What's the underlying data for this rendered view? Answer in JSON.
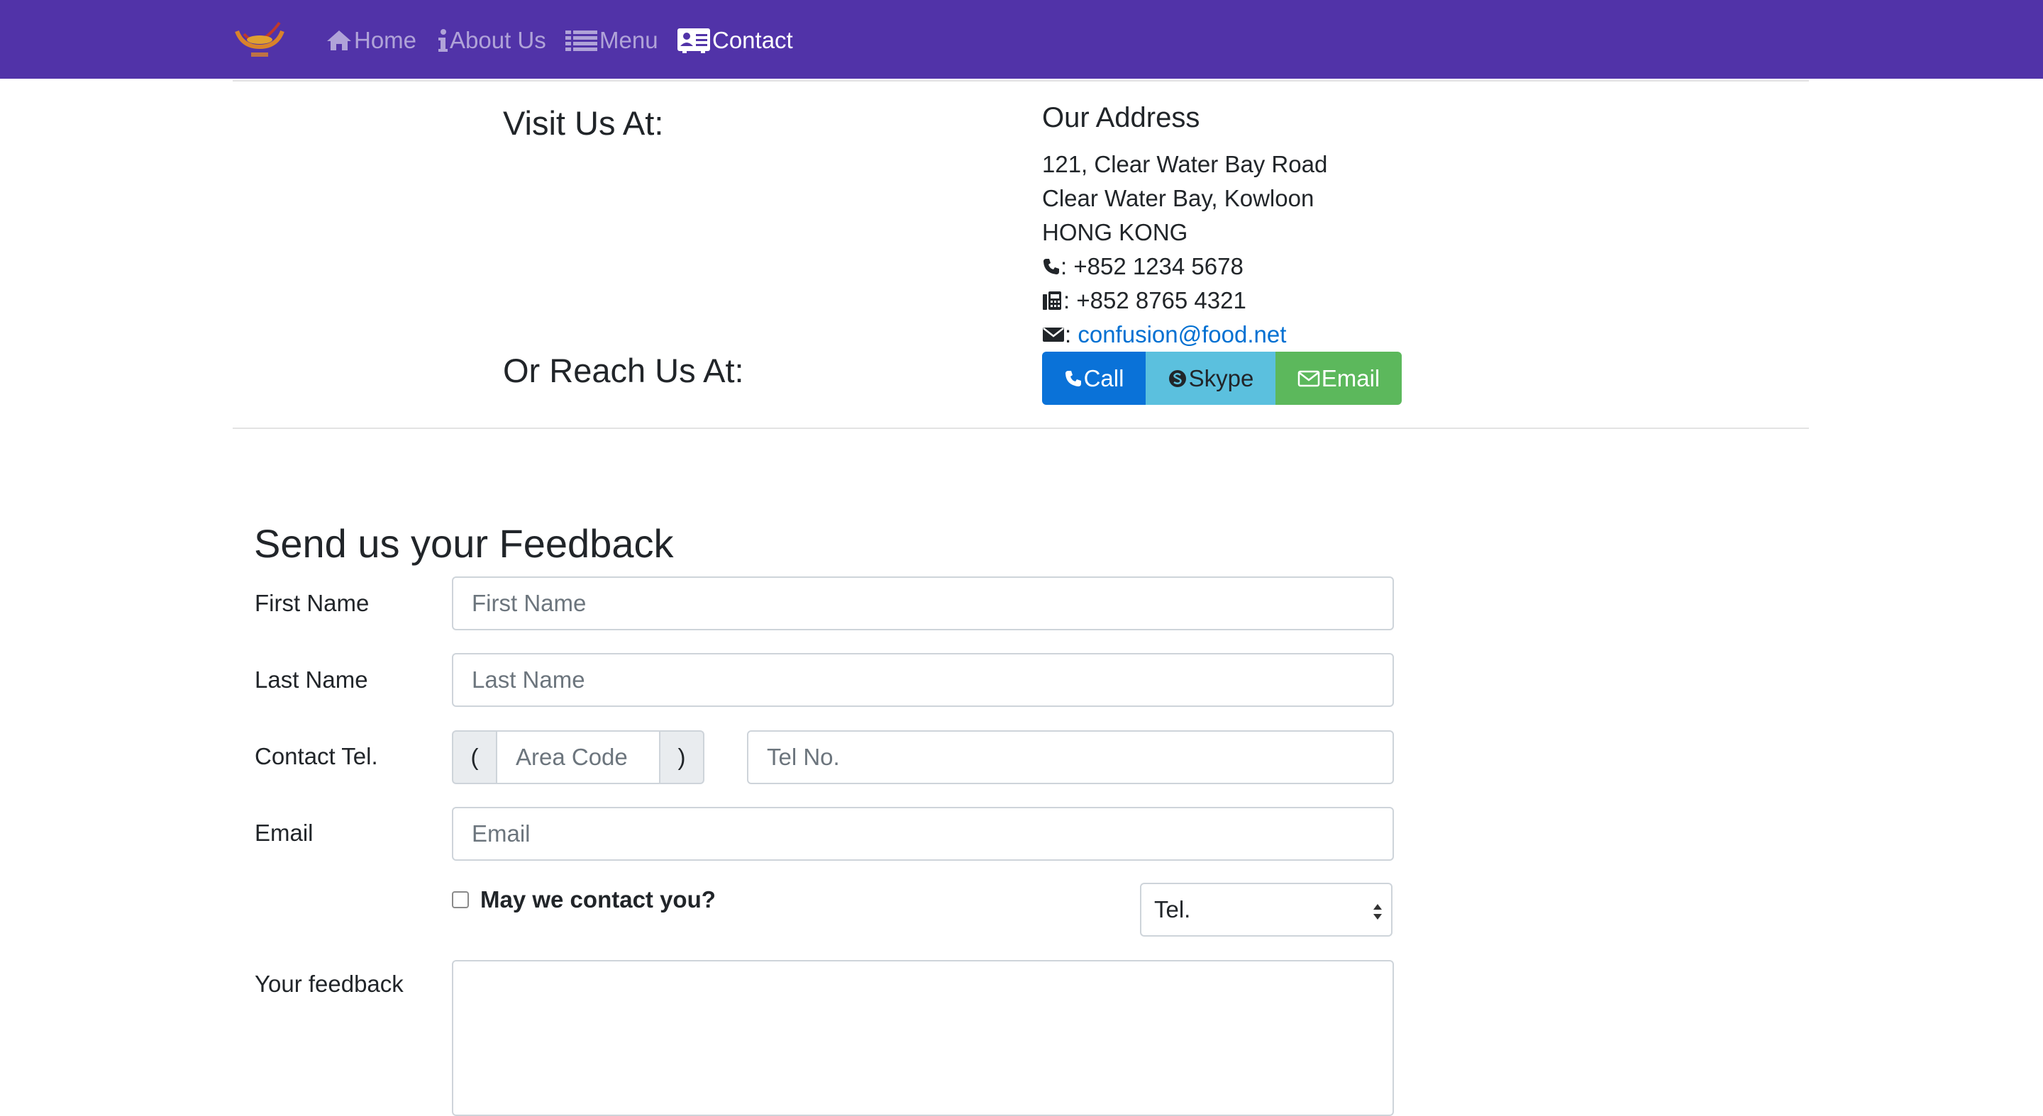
{
  "navbar": {
    "logo_alt": "Ristorante Con Fusion",
    "items": [
      {
        "label": "Home",
        "icon": "home-icon"
      },
      {
        "label": "About Us",
        "icon": "info-icon"
      },
      {
        "label": "Menu",
        "icon": "list-icon"
      },
      {
        "label": "Contact",
        "icon": "address-card-icon",
        "active": true
      }
    ]
  },
  "visit": {
    "heading": "Visit Us At:"
  },
  "reach": {
    "heading": "Or Reach Us At:"
  },
  "address": {
    "heading": "Our Address",
    "line1": "121, Clear Water Bay Road",
    "line2": "Clear Water Bay, Kowloon",
    "line3": "HONG KONG",
    "phone": ": +852 1234 5678",
    "fax": ": +852 8765 4321",
    "email_prefix": ": ",
    "email": "confusion@food.net"
  },
  "buttons": {
    "call": "Call",
    "skype": "Skype",
    "email": "Email"
  },
  "feedback": {
    "heading": "Send us your Feedback",
    "first_name_label": "First Name",
    "first_name_placeholder": "First Name",
    "last_name_label": "Last Name",
    "last_name_placeholder": "Last Name",
    "tel_label": "Contact Tel.",
    "open_paren": "(",
    "close_paren": ")",
    "area_code_placeholder": "Area Code",
    "tel_placeholder": "Tel No.",
    "email_label": "Email",
    "email_placeholder": "Email",
    "may_contact_label": "May we contact you?",
    "contact_method_selected": "Tel.",
    "feedback_label": "Your feedback",
    "feedback_value": ""
  },
  "colors": {
    "navbar_bg": "#5133a8",
    "call_btn": "#0a72d8",
    "skype_btn": "#5bc0de",
    "email_btn": "#5cb85c",
    "link": "#0070d2"
  }
}
